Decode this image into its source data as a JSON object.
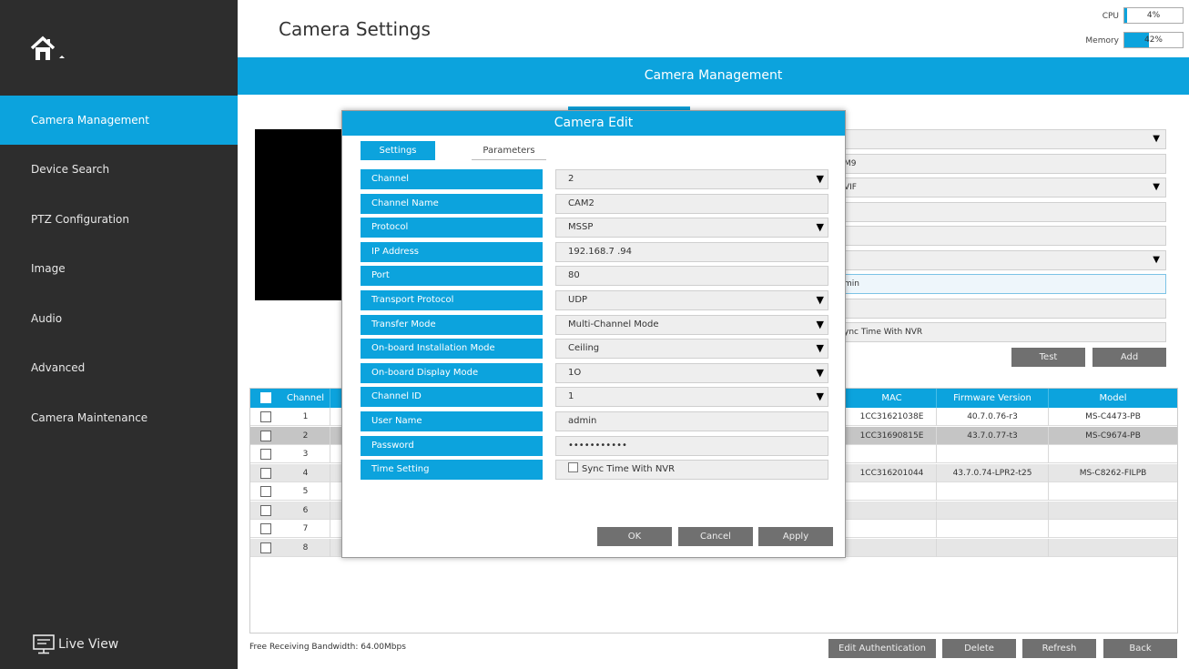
{
  "header": {
    "title": "Camera Settings",
    "cpu_label": "CPU",
    "cpu_value": "4%",
    "cpu_percent": 4,
    "memory_label": "Memory",
    "memory_value": "42%",
    "memory_percent": 42
  },
  "section_bar": "Camera Management",
  "sidebar": {
    "items": [
      {
        "label": "Camera Management",
        "active": true
      },
      {
        "label": "Device Search"
      },
      {
        "label": "PTZ Configuration"
      },
      {
        "label": "Image"
      },
      {
        "label": "Audio"
      },
      {
        "label": "Advanced"
      },
      {
        "label": "Camera Maintenance"
      }
    ],
    "live_view": "Live View"
  },
  "background_form": {
    "fields": [
      "",
      "M9",
      "VIF",
      "",
      "",
      "",
      "min",
      "",
      "ync Time With NVR"
    ],
    "test_button": "Test",
    "add_button": "Add"
  },
  "table": {
    "columns": [
      "Channel",
      "MAC",
      "Firmware Version",
      "Model"
    ],
    "rows": [
      {
        "channel": "1",
        "mac": "1CC31621038E",
        "firmware": "40.7.0.76-r3",
        "model": "MS-C4473-PB"
      },
      {
        "channel": "2",
        "mac": "1CC31690815E",
        "firmware": "43.7.0.77-t3",
        "model": "MS-C9674-PB"
      },
      {
        "channel": "3",
        "mac": "",
        "firmware": "",
        "model": ""
      },
      {
        "channel": "4",
        "mac": "1CC316201044",
        "firmware": "43.7.0.74-LPR2-t25",
        "model": "MS-C8262-FILPB"
      },
      {
        "channel": "5",
        "mac": "",
        "firmware": "",
        "model": ""
      },
      {
        "channel": "6",
        "mac": "",
        "firmware": "",
        "model": ""
      },
      {
        "channel": "7",
        "mac": "",
        "firmware": "",
        "model": ""
      },
      {
        "channel": "8",
        "mac": "",
        "firmware": "",
        "model": ""
      }
    ]
  },
  "footer": {
    "bandwidth": "Free Receiving Bandwidth: 64.00Mbps",
    "edit_auth": "Edit Authentication",
    "delete": "Delete",
    "refresh": "Refresh",
    "back": "Back"
  },
  "modal": {
    "title": "Camera Edit",
    "tab_settings": "Settings",
    "tab_parameters": "Parameters",
    "fields": [
      {
        "label": "Channel",
        "value": "2"
      },
      {
        "label": "Channel Name",
        "value": "CAM2"
      },
      {
        "label": "Protocol",
        "value": "MSSP"
      },
      {
        "label": "IP Address",
        "value": "192.168.7 .94"
      },
      {
        "label": "Port",
        "value": "80"
      },
      {
        "label": "Transport Protocol",
        "value": "UDP"
      },
      {
        "label": "Transfer Mode",
        "value": "Multi-Channel Mode"
      },
      {
        "label": "On-board Installation Mode",
        "value": "Ceiling"
      },
      {
        "label": "On-board Display Mode",
        "value": "1O"
      },
      {
        "label": "Channel ID",
        "value": "1"
      },
      {
        "label": "User Name",
        "value": "admin"
      },
      {
        "label": "Password",
        "value": "•••••••••••"
      },
      {
        "label": "Time Setting",
        "value": "Sync Time With NVR"
      }
    ],
    "ok": "OK",
    "cancel": "Cancel",
    "apply": "Apply"
  },
  "colors": {
    "accent": "#0ca3dd",
    "sidebar_bg": "#2d2d2d",
    "button_gray": "#707070"
  },
  "icons": {
    "home": "home-icon",
    "live_view": "monitor-icon",
    "dropdown": "triangle-down-icon"
  }
}
